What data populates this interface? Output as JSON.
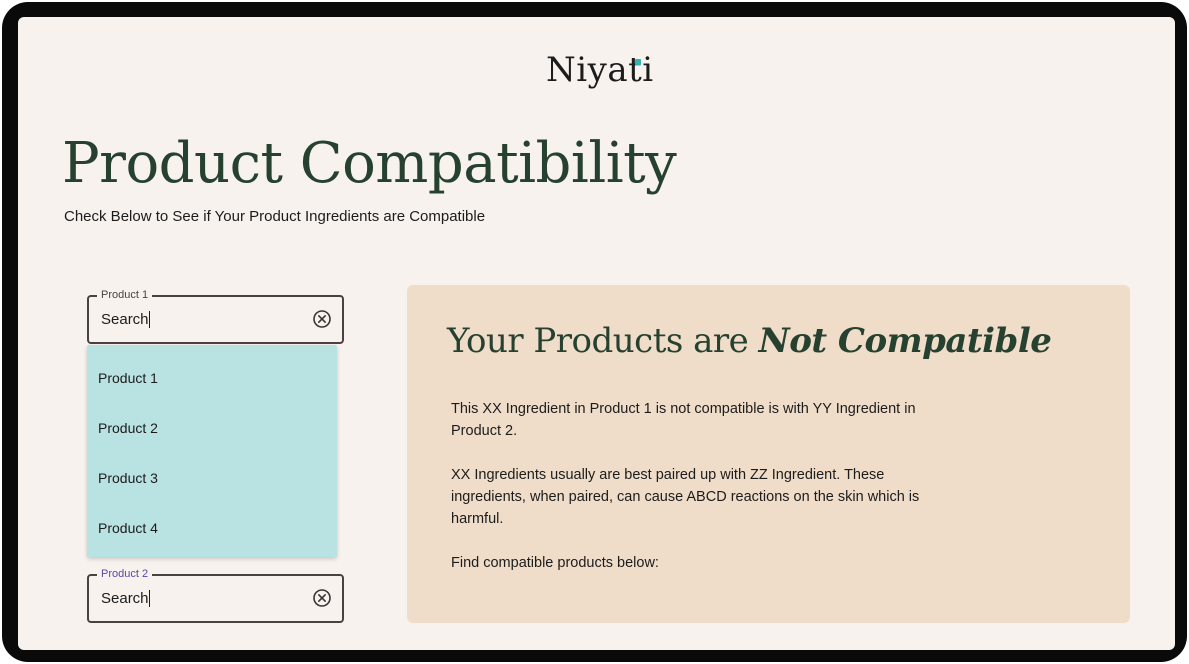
{
  "brand": {
    "logo_text": "Niyati",
    "accent_color": "#2fb3b3"
  },
  "header": {
    "title": "Product Compatibility",
    "subtitle": "Check Below to See if Your Product Ingredients are Compatible"
  },
  "product_1": {
    "label": "Product 1",
    "value": "Search",
    "clear_icon": "circle-x-icon"
  },
  "dropdown": {
    "options": [
      "Product 1",
      "Product 2",
      "Product 3",
      "Product 4"
    ],
    "background_color": "#b9e2e2"
  },
  "product_2": {
    "label": "Product 2",
    "value": "Search",
    "clear_icon": "circle-x-icon",
    "label_color": "#5b46a4"
  },
  "result": {
    "heading_prefix": "Your Products are",
    "heading_emphasis": "Not Compatible",
    "paragraph_1": "This XX Ingredient in Product 1 is not compatible is with YY Ingredient in Product 2.",
    "paragraph_2": "XX Ingredients usually are best paired up with ZZ Ingredient. These ingredients, when paired, can cause ABCD reactions on the skin which is harmful.",
    "paragraph_3": "Find compatible products below:",
    "background_color": "#f0ddc9"
  },
  "colors": {
    "heading_green": "#26412f",
    "page_background": "#f7f2ee"
  }
}
